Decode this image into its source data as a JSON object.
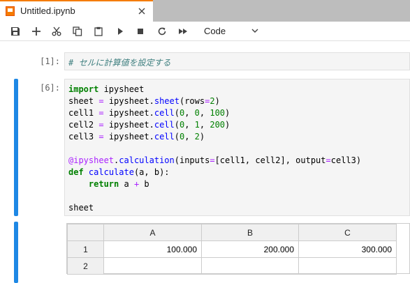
{
  "tab": {
    "title": "Untitled.ipynb",
    "icon": "notebook-icon",
    "close_icon": "close-icon",
    "accent": "#f57c00"
  },
  "toolbar": {
    "buttons": [
      "save-icon",
      "add-cell-icon",
      "cut-icon",
      "copy-icon",
      "paste-icon",
      "run-icon",
      "stop-icon",
      "restart-icon",
      "run-all-icon"
    ],
    "cell_type": "Code"
  },
  "cells": {
    "markdown": {
      "prompt": "[1]:",
      "text": "# セルに計算値を設定する"
    },
    "code": {
      "prompt": "[6]:",
      "lines": [
        "import ipysheet",
        "sheet = ipysheet.sheet(rows=2)",
        "cell1 = ipysheet.cell(0, 0, 100)",
        "cell2 = ipysheet.cell(0, 1, 200)",
        "cell3 = ipysheet.cell(0, 2)",
        "",
        "@ipysheet.calculation(inputs=[cell1, cell2], output=cell3)",
        "def calculate(a, b):",
        "    return a + b",
        "",
        "sheet"
      ]
    },
    "output": {
      "columns": [
        "",
        "A",
        "B",
        "C"
      ],
      "rows": [
        [
          "1",
          "100.000",
          "200.000",
          "300.000"
        ],
        [
          "2",
          "",
          "",
          ""
        ]
      ]
    }
  },
  "colors": {
    "active_cell_bar": "#1e88e5",
    "keyword": "#008000",
    "function": "#0000ff",
    "comment": "#408080"
  }
}
